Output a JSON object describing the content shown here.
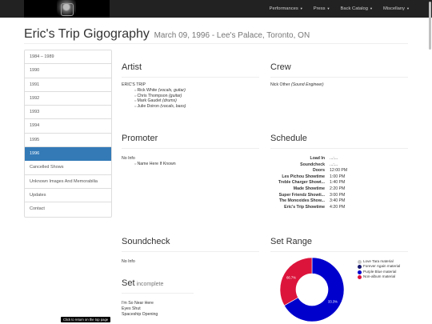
{
  "nav": {
    "items": [
      "Performances",
      "Press",
      "Back Catalog",
      "Miscellany"
    ]
  },
  "title": {
    "main": "Eric's Trip Gigography",
    "sub": "March 09, 1996 - Lee's Palace, Toronto, ON"
  },
  "sidebar": {
    "items": [
      "1984 – 1989",
      "1990",
      "1991",
      "1992",
      "1993",
      "1994",
      "1995",
      "1996",
      "Cancelled Shows",
      "Unknown Images And Memorabilia",
      "Updates",
      "Contact"
    ],
    "active": "1996"
  },
  "artist": {
    "heading": "Artist",
    "name": "ERIC'S TRIP",
    "members": [
      {
        "name": "Rick White",
        "role": "(vocals, guitar)"
      },
      {
        "name": "Chris Thompson",
        "role": "(guitar)"
      },
      {
        "name": "Mark Gaudet",
        "role": "(drums)"
      },
      {
        "name": "Julie Doiron",
        "role": "(vocals, bass)"
      }
    ]
  },
  "crew": {
    "heading": "Crew",
    "name": "Nick Other",
    "role": "(Sound Engineer)"
  },
  "promoter": {
    "heading": "Promoter",
    "info": "No Info",
    "item": "Name Here If Known"
  },
  "schedule": {
    "heading": "Schedule",
    "rows": [
      {
        "name": "Load In",
        "time": "...:..."
      },
      {
        "name": "Soundcheck",
        "time": "...:..."
      },
      {
        "name": "Doors",
        "time": "12:00 PM"
      },
      {
        "name": "Les Pichou Showtime",
        "time": "1:00 PM"
      },
      {
        "name": "Treble Charger Showt...",
        "time": "1:40 PM"
      },
      {
        "name": "Made Showtime",
        "time": "2:20 PM"
      },
      {
        "name": "Super Friendz Showti...",
        "time": "3:00 PM"
      },
      {
        "name": "The Monoxides Show...",
        "time": "3:40 PM"
      },
      {
        "name": "Eric's Trip Showtime",
        "time": "4:20 PM"
      }
    ]
  },
  "soundcheck": {
    "heading": "Soundcheck",
    "info": "No Info"
  },
  "set": {
    "heading": "Set",
    "status": "incomplete",
    "songs": [
      "I'm So Near Here",
      "Eyes Shut",
      "Spaceship Opening"
    ]
  },
  "set_range": {
    "heading": "Set Range",
    "legend": [
      "Love Tara material",
      "Forever Again material",
      "Purple Blue material",
      "Non-album material"
    ]
  },
  "chart_data": {
    "type": "pie",
    "categories": [
      "Love Tara material",
      "Forever Again material",
      "Purple Blue material",
      "Non-album material"
    ],
    "values": [
      0,
      0,
      66.7,
      33.3
    ],
    "colors": [
      "#c8c8c8",
      "#191970",
      "#0000cd",
      "#dc143c"
    ],
    "labels": [
      "33.3%",
      "66.7%"
    ]
  },
  "tooltip": "Click to return on the top page",
  "colors": {
    "navbar": "#222222",
    "active": "#337ab7"
  }
}
